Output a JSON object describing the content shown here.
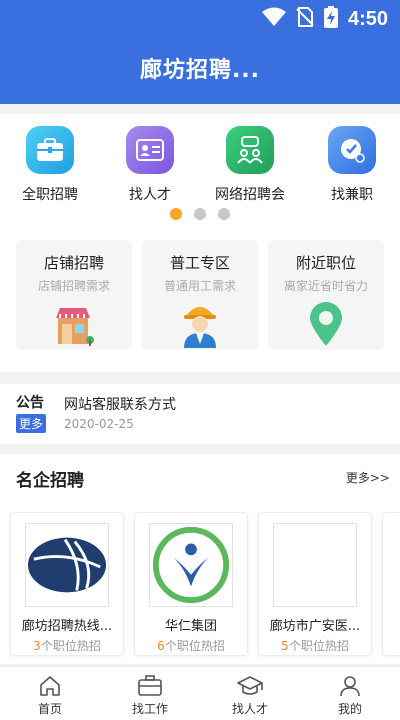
{
  "status": {
    "time": "4:50"
  },
  "header": {
    "title": "廊坊招聘..."
  },
  "quick_entries": [
    {
      "label": "全职招聘",
      "icon": "briefcase-icon",
      "color": "#29b6e8"
    },
    {
      "label": "找人才",
      "icon": "id-card-icon",
      "color": "#8a6ae6"
    },
    {
      "label": "网络招聘会",
      "icon": "group-chat-icon",
      "color": "#27b36b"
    },
    {
      "label": "找兼职",
      "icon": "clock-icon",
      "color": "#3a80e8"
    }
  ],
  "carousel": {
    "pages": 3,
    "active": 0
  },
  "feature_cards": [
    {
      "title": "店铺招聘",
      "subtitle": "店铺招聘需求",
      "icon": "shop-icon"
    },
    {
      "title": "普工专区",
      "subtitle": "普通用工需求",
      "icon": "worker-icon"
    },
    {
      "title": "附近职位",
      "subtitle": "离家近省时省力",
      "icon": "location-pin-icon"
    }
  ],
  "notice": {
    "label": "公告",
    "more": "更多",
    "title": "网站客服联系方式",
    "date": "2020-02-25"
  },
  "famous": {
    "heading": "名企招聘",
    "more": "更多>>",
    "companies": [
      {
        "name": "廊坊招聘热线...",
        "count": "3",
        "suffix": "个职位热招"
      },
      {
        "name": "华仁集团",
        "count": "6",
        "suffix": "个职位热招"
      },
      {
        "name": "廊坊市广安医...",
        "count": "5",
        "suffix": "个职位热招"
      }
    ]
  },
  "tabbar": [
    {
      "label": "首页",
      "icon": "home-icon"
    },
    {
      "label": "找工作",
      "icon": "briefcase-icon"
    },
    {
      "label": "找人才",
      "icon": "graduation-cap-icon"
    },
    {
      "label": "我的",
      "icon": "user-icon"
    }
  ]
}
